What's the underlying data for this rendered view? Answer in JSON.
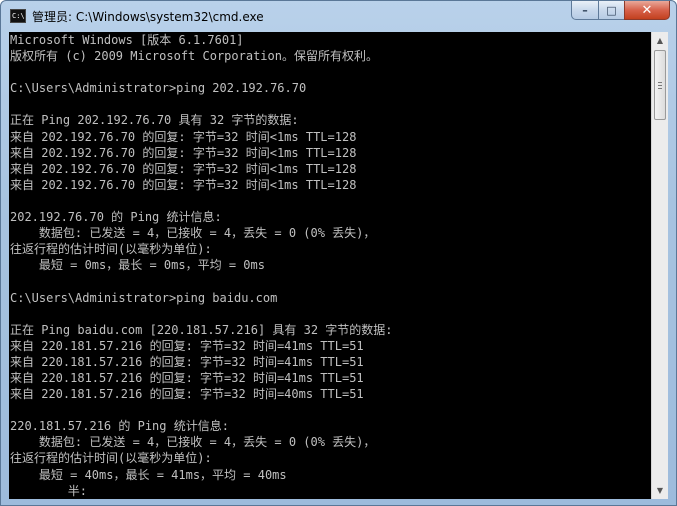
{
  "window": {
    "title": "管理员: C:\\Windows\\system32\\cmd.exe",
    "icon_text": "C:\\",
    "icon": "cmd-icon",
    "buttons": {
      "minimize": "–",
      "maximize": "□",
      "close": "✕"
    }
  },
  "console": {
    "lines": [
      "Microsoft Windows [版本 6.1.7601]",
      "版权所有 (c) 2009 Microsoft Corporation。保留所有权利。",
      "",
      "C:\\Users\\Administrator>ping 202.192.76.70",
      "",
      "正在 Ping 202.192.76.70 具有 32 字节的数据:",
      "来自 202.192.76.70 的回复: 字节=32 时间<1ms TTL=128",
      "来自 202.192.76.70 的回复: 字节=32 时间<1ms TTL=128",
      "来自 202.192.76.70 的回复: 字节=32 时间<1ms TTL=128",
      "来自 202.192.76.70 的回复: 字节=32 时间<1ms TTL=128",
      "",
      "202.192.76.70 的 Ping 统计信息:",
      "    数据包: 已发送 = 4，已接收 = 4，丢失 = 0 (0% 丢失)，",
      "往返行程的估计时间(以毫秒为单位):",
      "    最短 = 0ms，最长 = 0ms，平均 = 0ms",
      "",
      "C:\\Users\\Administrator>ping baidu.com",
      "",
      "正在 Ping baidu.com [220.181.57.216] 具有 32 字节的数据:",
      "来自 220.181.57.216 的回复: 字节=32 时间=41ms TTL=51",
      "来自 220.181.57.216 的回复: 字节=32 时间=41ms TTL=51",
      "来自 220.181.57.216 的回复: 字节=32 时间=41ms TTL=51",
      "来自 220.181.57.216 的回复: 字节=32 时间=40ms TTL=51",
      "",
      "220.181.57.216 的 Ping 统计信息:",
      "    数据包: 已发送 = 4，已接收 = 4，丢失 = 0 (0% 丢失)，",
      "往返行程的估计时间(以毫秒为单位):",
      "    最短 = 40ms，最长 = 41ms，平均 = 40ms",
      "        半:"
    ]
  },
  "scrollbar": {
    "up_arrow": "▲",
    "down_arrow": "▼"
  },
  "colors": {
    "console_bg": "#000000",
    "console_text": "#c0c0c0",
    "close_button": "#c9452a"
  }
}
